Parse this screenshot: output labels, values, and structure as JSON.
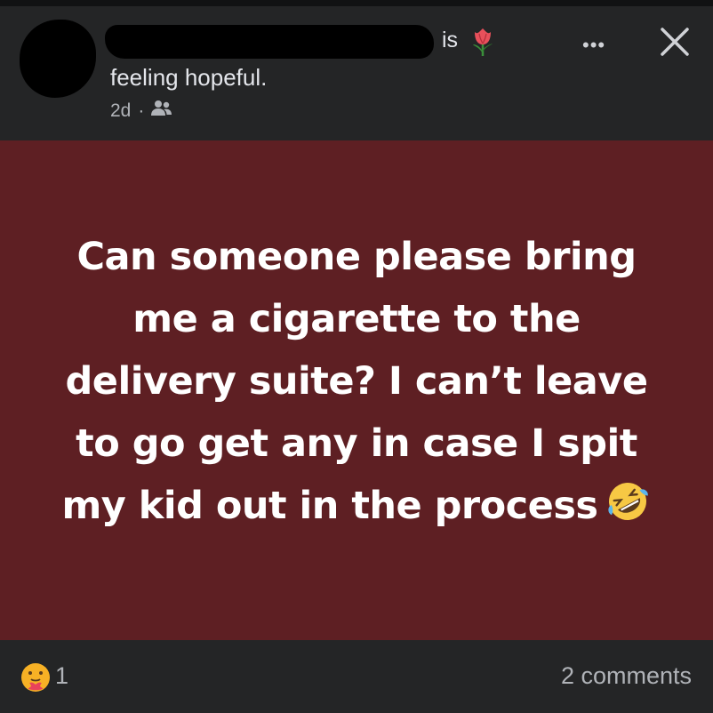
{
  "header": {
    "status_verb": "is",
    "status_icon": "tulip-icon",
    "feeling": "feeling hopeful.",
    "time": "2d",
    "separator": "·",
    "audience_icon": "friends-icon",
    "more_label": "•••",
    "close_icon": "close-icon"
  },
  "post": {
    "text": "Can someone please bring me a cigarette to the delivery suite? I can’t leave to go get any in case I spit my kid out in the process",
    "trailing_emoji": "rolling-on-floor-laughing-icon",
    "background_color": "#5e1f23"
  },
  "footer": {
    "reaction_icon": "care-reaction-icon",
    "reaction_count": "1",
    "comments": "2 comments"
  }
}
